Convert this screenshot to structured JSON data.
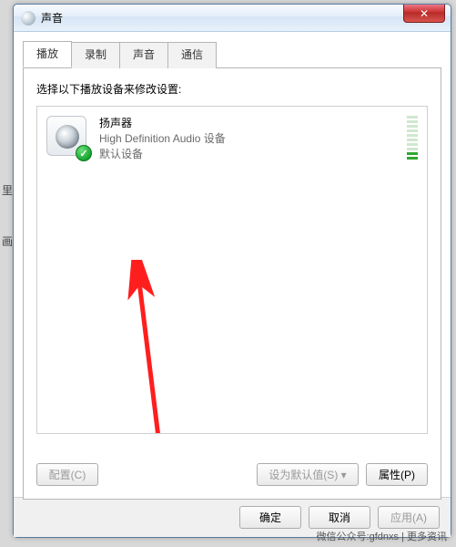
{
  "window": {
    "title": "声音"
  },
  "tabs": [
    {
      "label": "播放",
      "active": true
    },
    {
      "label": "录制",
      "active": false
    },
    {
      "label": "声音",
      "active": false
    },
    {
      "label": "通信",
      "active": false
    }
  ],
  "instruction": "选择以下播放设备来修改设置:",
  "devices": [
    {
      "name": "扬声器",
      "description": "High Definition Audio 设备",
      "status": "默认设备",
      "icon": "speaker-icon",
      "default": true,
      "meter_levels": 10,
      "meter_active": 2
    }
  ],
  "panel_buttons": {
    "configure": "配置(C)",
    "set_default": "设为默认值(S)",
    "properties": "属性(P)"
  },
  "footer_buttons": {
    "ok": "确定",
    "cancel": "取消",
    "apply": "应用(A)"
  },
  "watermark": "微信公众号:gfdnxs  |  更多资讯",
  "left_fragments": [
    "里",
    "画"
  ]
}
